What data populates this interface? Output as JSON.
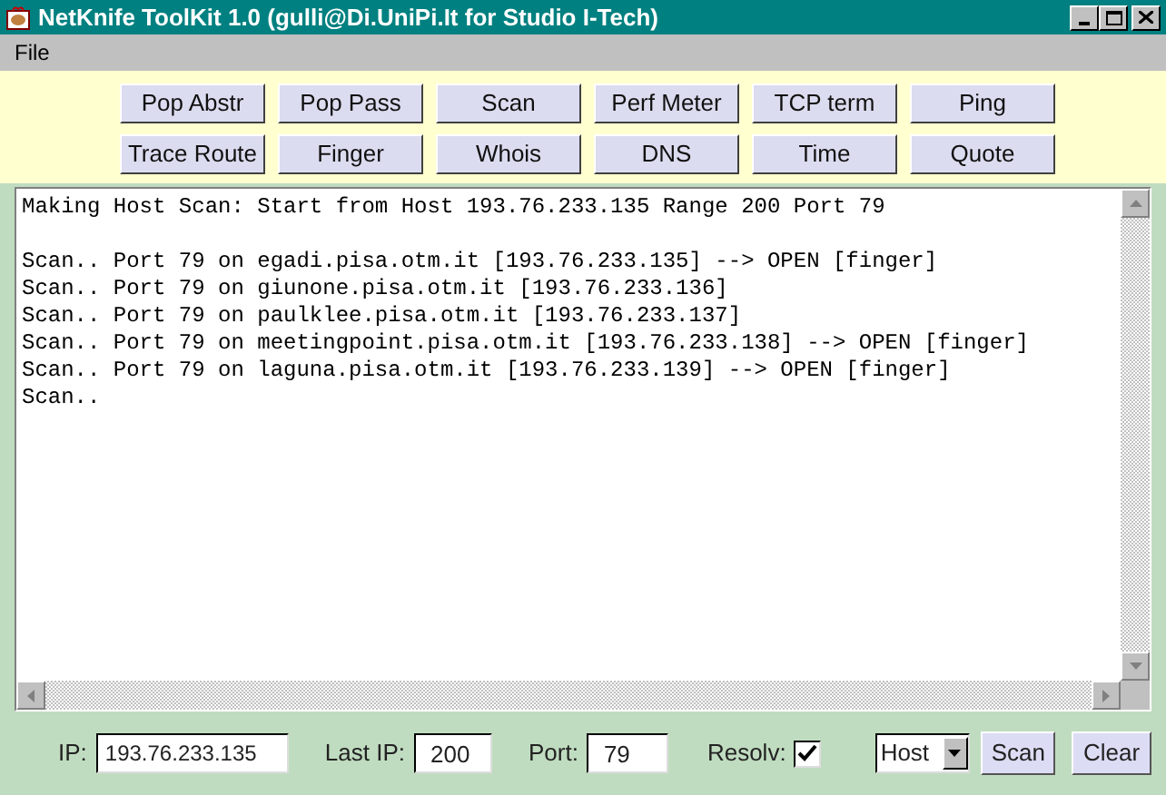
{
  "window": {
    "title": "NetKnife ToolKit 1.0 (gulli@Di.UniPi.It for Studio I-Tech)"
  },
  "menu": [
    "File"
  ],
  "tool_buttons": [
    [
      "Pop Abstr",
      "Pop Pass",
      "Scan",
      "Perf Meter",
      "TCP term",
      "Ping"
    ],
    [
      "Trace Route",
      "Finger",
      "Whois",
      "DNS",
      "Time",
      "Quote"
    ]
  ],
  "log": {
    "header": "Making Host Scan: Start from Host 193.76.233.135 Range 200 Port 79",
    "lines": [
      "Scan.. Port 79 on egadi.pisa.otm.it [193.76.233.135] --> OPEN [finger]",
      "Scan.. Port 79 on giunone.pisa.otm.it [193.76.233.136]",
      "Scan.. Port 79 on paulklee.pisa.otm.it [193.76.233.137]",
      "Scan.. Port 79 on meetingpoint.pisa.otm.it [193.76.233.138] --> OPEN [finger]",
      "Scan.. Port 79 on laguna.pisa.otm.it [193.76.233.139] --> OPEN [finger]",
      "Scan.."
    ]
  },
  "controls": {
    "ip_label": "IP:",
    "ip": "193.76.233.135",
    "last_ip_label": "Last IP:",
    "last_ip": "200",
    "port_label": "Port:",
    "port": "79",
    "resolv_label": "Resolv:",
    "resolv_checked": true,
    "mode": "Host",
    "scan_button": "Scan",
    "clear_button": "Clear"
  }
}
